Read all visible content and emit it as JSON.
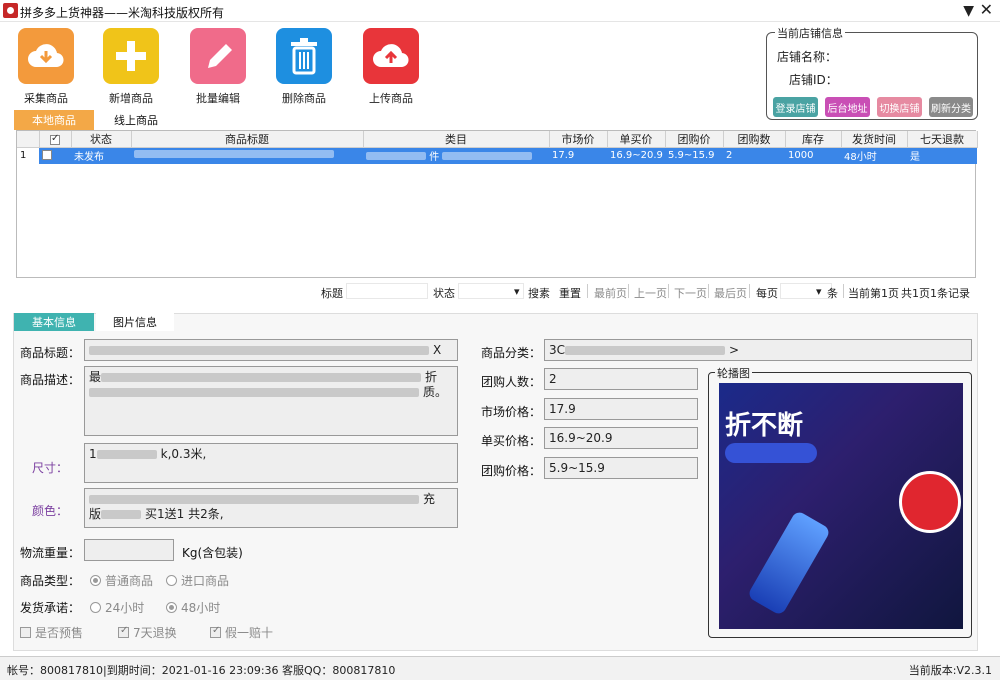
{
  "window": {
    "title": "拼多多上货神器——米淘科技版权所有",
    "menu_glyph": "▼",
    "close_glyph": "✕"
  },
  "toolbar": [
    {
      "label": "采集商品",
      "icon": "cloud-download-icon",
      "color": "#f39a3c"
    },
    {
      "label": "新增商品",
      "icon": "plus-icon",
      "color": "#f0c419"
    },
    {
      "label": "批量编辑",
      "icon": "pencil-icon",
      "color": "#f06b8a"
    },
    {
      "label": "删除商品",
      "icon": "trash-icon",
      "color": "#1e8fe0"
    },
    {
      "label": "上传商品",
      "icon": "cloud-upload-icon",
      "color": "#e8353a"
    }
  ],
  "shop": {
    "legend": "当前店铺信息",
    "name_label": "店铺名称：",
    "id_label": "店铺ID：",
    "buttons": {
      "login": "登录店铺",
      "admin": "后台地址",
      "switch": "切换店铺",
      "refresh": "刷新分类"
    }
  },
  "main_tabs": {
    "local": "本地商品",
    "online": "线上商品"
  },
  "grid": {
    "headers": [
      "状态",
      "商品标题",
      "类目",
      "市场价",
      "单买价",
      "团购价",
      "团购数",
      "库存",
      "发货时间",
      "七天退款"
    ],
    "row": {
      "num": "1",
      "status": "未发布",
      "category_suffix": "件",
      "market_price": "17.9",
      "single_price": "16.9~20.9",
      "group_price": "5.9~15.9",
      "group_count": "2",
      "stock": "1000",
      "ship_time": "48小时",
      "refund": "是"
    }
  },
  "search": {
    "title_label": "标题",
    "status_label": "状态",
    "dropdown_glyph": "▾",
    "search_btn": "搜素",
    "reset_btn": "重置",
    "first_page": "最前页",
    "prev_page": "上一页",
    "next_page": "下一页",
    "last_page": "最后页",
    "per_page_label": "每页",
    "items_label": "条",
    "current_page": "当前第1页",
    "total": "共1页1条记录"
  },
  "detail_tabs": {
    "basic": "基本信息",
    "images": "图片信息"
  },
  "detail": {
    "title_label": "商品标题：",
    "title_suffix": "X",
    "desc_label": "商品描述：",
    "desc_prefix": "最",
    "desc_mid": "折",
    "desc_end": "质。",
    "size_label": "尺寸：",
    "size_prefix": "1",
    "size_suffix": "k,0.3米,",
    "color_label": "颜色：",
    "color_mid": "充",
    "color_line2_prefix": "版",
    "color_line2_suffix": "买1送1 共2条,",
    "weight_label": "物流重量：",
    "weight_unit": "Kg(含包装)",
    "type_label": "商品类型：",
    "type_options": [
      "普通商品",
      "进口商品"
    ],
    "ship_label": "发货承诺：",
    "ship_options": [
      "24小时",
      "48小时"
    ],
    "checks": [
      "是否预售",
      "7天退换",
      "假一赔十"
    ],
    "category_label": "商品分类：",
    "category_prefix": "3C",
    "category_suffix": ">",
    "group_size_label": "团购人数：",
    "group_size": "2",
    "market_price_label": "市场价格：",
    "market_price": "17.9",
    "single_price_label": "单买价格：",
    "single_price": "16.9~20.9",
    "group_price_label": "团购价格：",
    "group_price": "5.9~15.9",
    "carousel_legend": "轮播图",
    "carousel_banner": "折不断"
  },
  "status": {
    "left": "帐号：800817810|到期时间：2021-01-16 23:09:36  客服QQ：800817810",
    "right": "当前版本:V2.3.1"
  }
}
